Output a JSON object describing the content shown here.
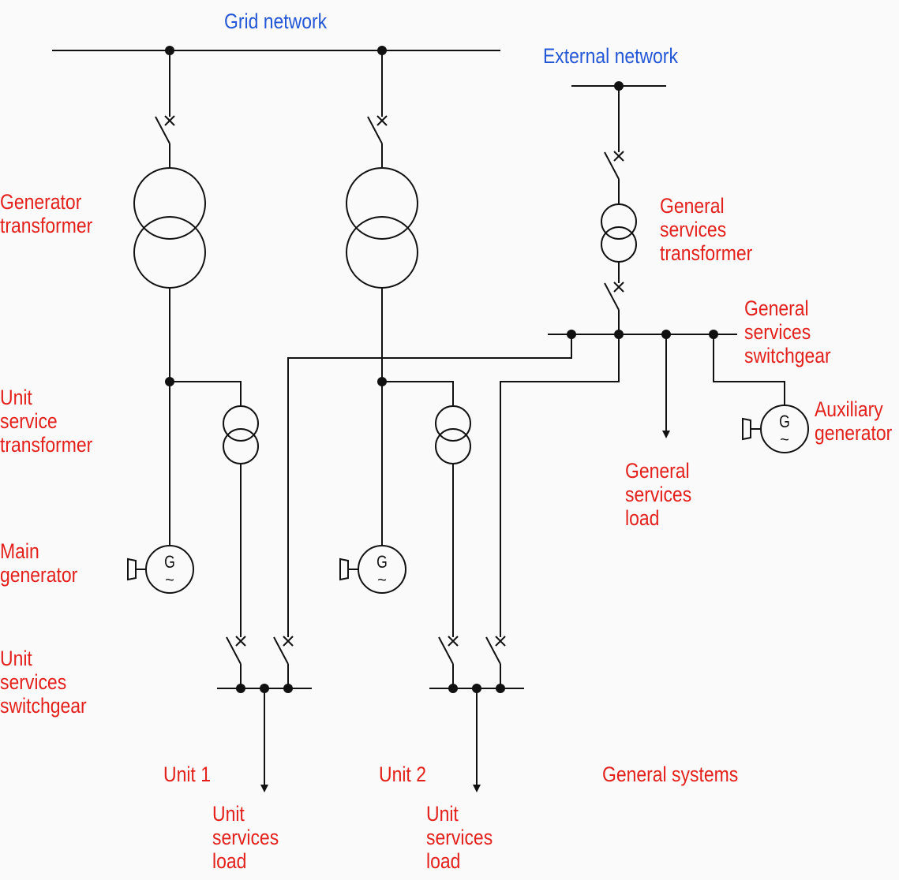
{
  "colors": {
    "network_label": "#2357d6",
    "component_label": "#e3201b",
    "line": "#111111"
  },
  "labels": {
    "grid_network": "Grid network",
    "external_network": "External network",
    "generator_transformer": "Generator\ntransformer",
    "general_services_transformer": "General\nservices\ntransformer",
    "general_services_switchgear": "General\nservices\nswitchgear",
    "unit_service_transformer": "Unit\nservice\ntransformer",
    "auxiliary_generator": "Auxiliary\ngenerator",
    "general_services_load": "General\nservices\nload",
    "main_generator": "Main\ngenerator",
    "unit_services_switchgear": "Unit\nservices\nswitchgear",
    "unit1": "Unit 1",
    "unit2": "Unit 2",
    "general_systems": "General systems",
    "unit_services_load_1": "Unit\nservices\nload",
    "unit_services_load_2": "Unit\nservices\nload"
  },
  "generator_symbol": {
    "letter": "G",
    "ac": "~"
  }
}
